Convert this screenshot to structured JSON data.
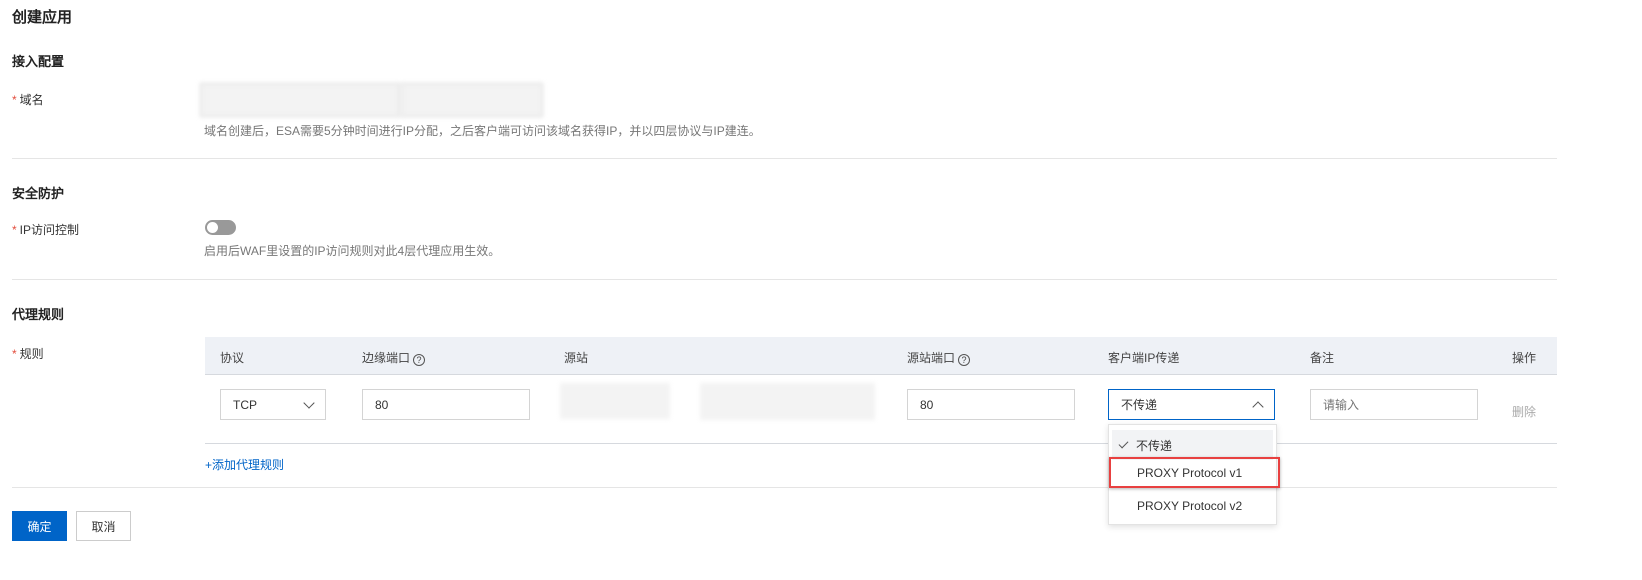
{
  "page_title": "创建应用",
  "access": {
    "section": "接入配置",
    "domain_label": "域名",
    "domain_hint": "域名创建后，ESA需要5分钟时间进行IP分配，之后客户端可访问该域名获得IP，并以四层协议与IP建连。"
  },
  "security": {
    "section": "安全防护",
    "ip_label": "IP访问控制",
    "ip_enabled": false,
    "ip_hint": "启用后WAF里设置的IP访问规则对此4层代理应用生效。"
  },
  "proxy": {
    "section": "代理规则",
    "rules_label": "规则",
    "columns": {
      "protocol": "协议",
      "edge_port": "边缘端口",
      "origin": "源站",
      "origin_port": "源站端口",
      "client_ip": "客户端IP传递",
      "remark": "备注",
      "action": "操作"
    },
    "help_glyph": "?",
    "row": {
      "protocol": "TCP",
      "edge_port": "80",
      "origin_port": "80",
      "client_ip": "不传递",
      "remark_placeholder": "请输入",
      "delete": "删除"
    },
    "add_rule": "+添加代理规则",
    "dropdown": {
      "options": [
        "不传递",
        "PROXY Protocol v1",
        "PROXY Protocol v2"
      ],
      "selected": "不传递",
      "highlighted": "PROXY Protocol v1"
    }
  },
  "buttons": {
    "confirm": "确定",
    "cancel": "取消"
  },
  "colors": {
    "primary": "#0064c8",
    "highlight": "#e84040"
  }
}
